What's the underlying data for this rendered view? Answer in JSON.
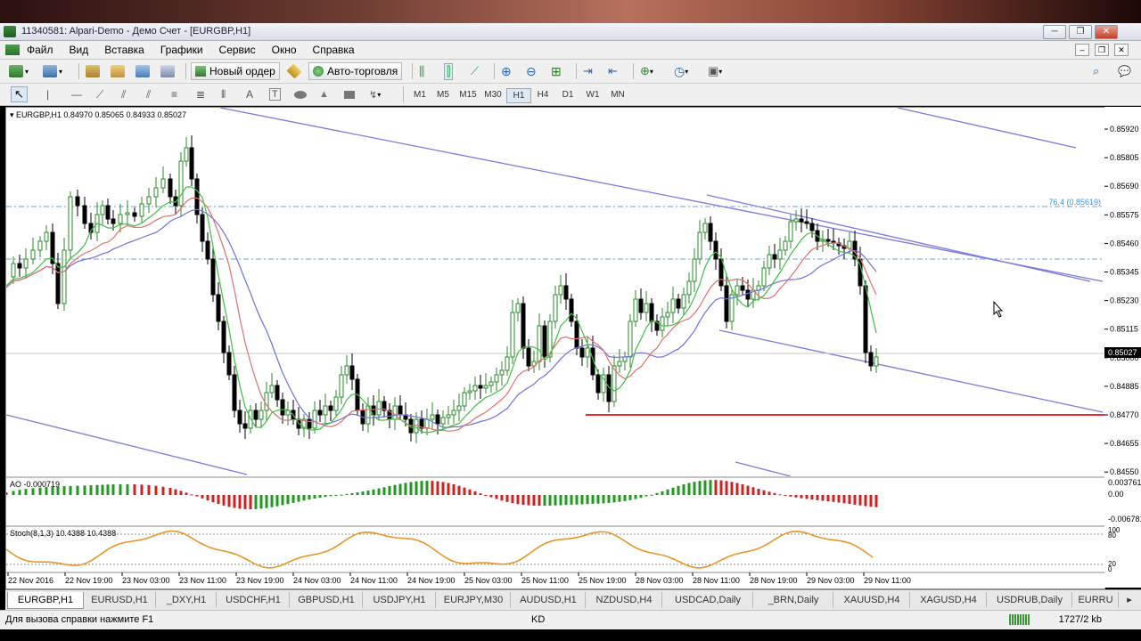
{
  "window": {
    "title": "11340581: Alpari-Demo - Демо Счет - [EURGBP,H1]"
  },
  "menu": {
    "items": [
      "Файл",
      "Вид",
      "Вставка",
      "Графики",
      "Сервис",
      "Окно",
      "Справка"
    ]
  },
  "toolbar": {
    "new_order": "Новый ордер",
    "auto_trading": "Авто-торговля"
  },
  "timeframes": [
    "M1",
    "M5",
    "M15",
    "M30",
    "H1",
    "H4",
    "D1",
    "W1",
    "MN"
  ],
  "active_timeframe": "H1",
  "chart": {
    "header": "EURGBP,H1  0.84970 0.85065 0.84933 0.85027",
    "fib_label": "76.4 (0.85619)",
    "current_price": "0.85027",
    "price_ticks": [
      "0.85920",
      "0.85805",
      "0.85690",
      "0.85575",
      "0.85460",
      "0.85345",
      "0.85230",
      "0.85115",
      "0.85000",
      "0.84885",
      "0.84770",
      "0.84655",
      "0.84550"
    ],
    "ao_label": "AO -0.000719",
    "ao_ticks": [
      "0.003761",
      "0.00",
      "-0.006781"
    ],
    "stoch_label": "Stoch(8,1,3) 10.4388 10.4388",
    "stoch_ticks": [
      "100",
      "80",
      "20",
      "0"
    ],
    "time_labels": [
      "22 Nov 2016",
      "22 Nov 19:00",
      "23 Nov 03:00",
      "23 Nov 11:00",
      "23 Nov 19:00",
      "24 Nov 03:00",
      "24 Nov 11:00",
      "24 Nov 19:00",
      "25 Nov 03:00",
      "25 Nov 11:00",
      "25 Nov 19:00",
      "28 Nov 03:00",
      "28 Nov 11:00",
      "28 Nov 19:00",
      "29 Nov 03:00",
      "29 Nov 11:00"
    ]
  },
  "tabs": [
    "EURGBP,H1",
    "EURUSD,H1",
    "_DXY,H1",
    "USDCHF,H1",
    "GBPUSD,H1",
    "USDJPY,H1",
    "EURJPY,M30",
    "AUDUSD,H1",
    "NZDUSD,H4",
    "USDCAD,Daily",
    "_BRN,Daily",
    "XAUUSD,H4",
    "XAGUSD,H4",
    "USDRUB,Daily",
    "EURRU"
  ],
  "active_tab": "EURGBP,H1",
  "status": {
    "help": "Для вызова справки нажмите F1",
    "profile": "KD",
    "traffic": "1727/2 kb"
  },
  "colors": {
    "bull": "#2b8a2b",
    "bear": "#000000",
    "channel": "#7070e0",
    "support": "#e03030",
    "ma_fast": "#40c040",
    "ma_mid": "#e07070",
    "ma_slow": "#7070e0",
    "stoch": "#e8962a",
    "ao_up": "#1f9a1f",
    "ao_down": "#d02020"
  },
  "chart_data": {
    "type": "candlestick",
    "symbol": "EURGBP",
    "timeframe": "H1",
    "ylim": [
      0.8455,
      0.8598
    ],
    "support_level": 0.8477,
    "fib_level": 0.85619,
    "last_close": 0.85027
  }
}
